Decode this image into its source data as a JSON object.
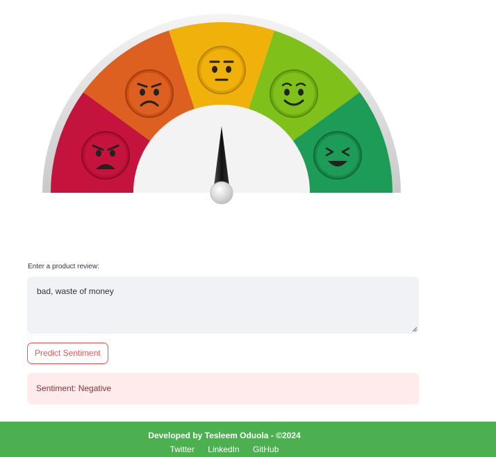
{
  "gauge": {
    "faces": [
      "angry-face-icon",
      "frowning-face-icon",
      "neutral-face-icon",
      "smiling-face-icon",
      "grinning-face-icon"
    ],
    "colors": {
      "angry": "#c4143e",
      "frowning": "#de6020",
      "neutral": "#f1b10b",
      "smiling": "#7fc11a",
      "grinning": "#1c9c56"
    }
  },
  "form": {
    "label": "Enter a product review:",
    "review_value": "bad, waste of money",
    "predict_label": "Predict Sentiment",
    "result_text": "Sentiment: Negative"
  },
  "footer": {
    "credit": "Developed by Tesleem Oduola - ©2024",
    "links": [
      "Twitter",
      "LinkedIn",
      "GitHub"
    ],
    "background": "#4caf50"
  }
}
